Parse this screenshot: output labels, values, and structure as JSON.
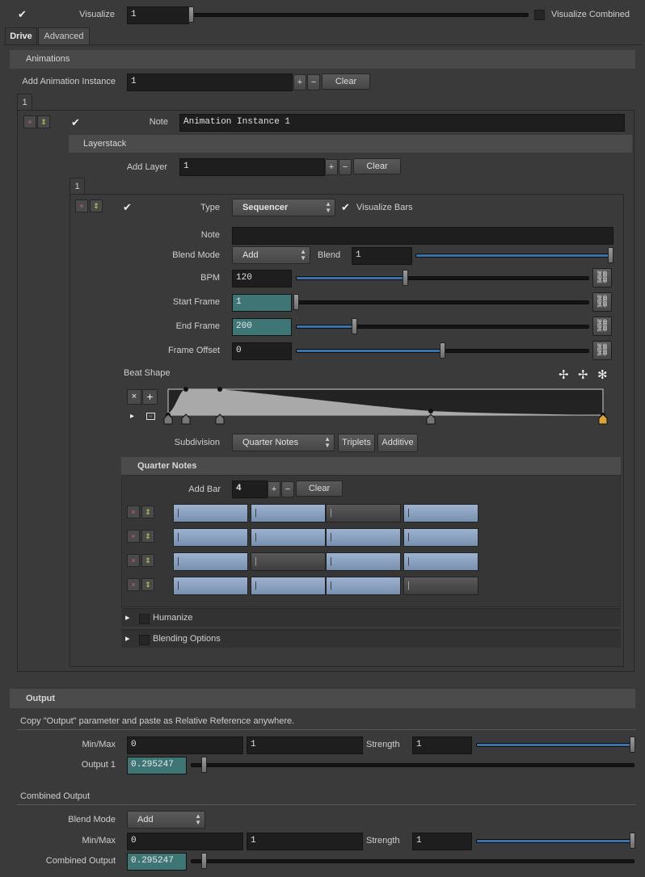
{
  "top": {
    "visualize_label": "Visualize",
    "visualize_value": "1",
    "visualize_fraction": 0.0,
    "visualize_combined_label": "Visualize Combined"
  },
  "tabs": [
    {
      "label": "Drive"
    },
    {
      "label": "Advanced"
    }
  ],
  "animations": {
    "header": "Animations",
    "add_instance_label": "Add Animation Instance",
    "add_instance_value": "1",
    "clear_label": "Clear",
    "plus": "+",
    "minus": "−",
    "instance_tab": "1",
    "note_label": "Note",
    "note_value": "Animation Instance 1",
    "layerstack": {
      "header": "Layerstack",
      "add_layer_label": "Add Layer",
      "add_layer_value": "1",
      "clear_label": "Clear",
      "layer_tab": "1",
      "type_label": "Type",
      "type_value": "Sequencer",
      "visualize_bars_label": "Visualize Bars",
      "note_label": "Note",
      "note_value": "",
      "blend_mode_label": "Blend Mode",
      "blend_mode_value": "Add",
      "blend_label": "Blend",
      "blend_value": "1",
      "blend_fraction": 1.0,
      "bpm_label": "BPM",
      "bpm_value": "120",
      "bpm_fraction": 0.37,
      "start_frame_label": "Start Frame",
      "start_frame_value": "1",
      "start_frame_fraction": 0.0,
      "end_frame_label": "End Frame",
      "end_frame_value": "200",
      "end_frame_fraction": 0.2,
      "frame_offset_label": "Frame Offset",
      "frame_offset_value": "0",
      "frame_offset_fraction": 0.5,
      "beat_shape_label": "Beat Shape",
      "subdivision_label": "Subdivision",
      "subdivision_value": "Quarter Notes",
      "triplets_label": "Triplets",
      "additive_label": "Additive",
      "quarter_notes": {
        "header": "Quarter Notes",
        "add_bar_label": "Add Bar",
        "add_bar_value": "4",
        "clear_label": "Clear",
        "bars": [
          [
            true,
            true,
            false,
            true
          ],
          [
            true,
            true,
            true,
            true
          ],
          [
            true,
            false,
            true,
            true
          ],
          [
            true,
            true,
            true,
            false
          ]
        ],
        "cell_marker": "|"
      },
      "humanize_label": "Humanize",
      "blending_options_label": "Blending Options"
    }
  },
  "output": {
    "header": "Output",
    "description": "Copy \"Output\" parameter and paste as Relative Reference anywhere.",
    "minmax_label": "Min/Max",
    "min_value": "0",
    "max_value": "1",
    "strength_label": "Strength",
    "strength_value": "1",
    "strength_fraction": 1.0,
    "output1_label": "Output 1",
    "output1_value": "0.295247",
    "output1_fraction": 0.02,
    "combined_header": "Combined Output",
    "blend_mode_label": "Blend Mode",
    "blend_mode_value": "Add",
    "c_minmax_label": "Min/Max",
    "c_min_value": "0",
    "c_max_value": "1",
    "c_strength_label": "Strength",
    "c_strength_value": "1",
    "combined_label": "Combined Output",
    "combined_value": "0.295247"
  },
  "icons": {
    "check": "✔",
    "x": "×",
    "updown": "⇕",
    "link": "🔗",
    "plus": "+",
    "play": "▸",
    "expand": "▸",
    "gear": "✻",
    "move": "✢"
  },
  "colors": {
    "accent": "#3d6fa8",
    "teal_field": "#3e7676",
    "bar_on": "#8ea3c2",
    "background": "#3a3a3a"
  }
}
